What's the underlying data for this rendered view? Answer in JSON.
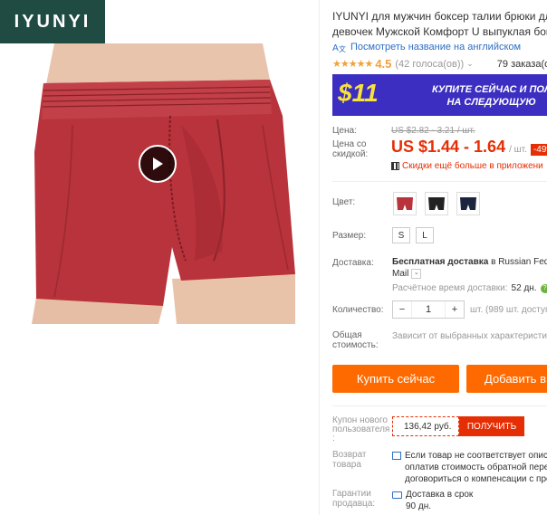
{
  "brand": {
    "logo_text": "IYUNYI"
  },
  "media": {
    "has_video": true
  },
  "product": {
    "title_line1": "IYUNYI для мужчин боксер талии брюки для",
    "title_line2": "девочек Мужской Комфорт U выпуклая бокс",
    "translate_link": "Посмотреть название на английском",
    "rating": "4.5",
    "rating_stars": 4.5,
    "votes": "(42 голоса(ов))",
    "orders": "79 заказа(ов)"
  },
  "banner": {
    "amount": "$11",
    "line1": "КУПИТЕ СЕЙЧАС И ПОЛ",
    "line2": "НА СЛЕДУЮЩУЮ"
  },
  "price": {
    "label": "Цена:",
    "old_value": "US $2.82 - 3.21 / шт.",
    "discount_label": "Цена со скидкой:",
    "sale_value": "US $1.44 - 1.64",
    "per_unit": "/ шт.",
    "discount_badge": "-49%",
    "app_deal": "Скидки ещё больше в приложени"
  },
  "options": {
    "color_label": "Цвет:",
    "colors": [
      "red-boxer",
      "black-boxer",
      "navy-boxer"
    ],
    "size_label": "Размер:",
    "sizes": [
      "S",
      "L"
    ]
  },
  "shipping": {
    "label": "Доставка:",
    "value_bold": "Бесплатная доставка",
    "value_to": "в",
    "destination": "Russian Fede",
    "carrier": "Mail",
    "eta_label": "Расчётное время доставки:",
    "eta_value": "52 дн."
  },
  "quantity": {
    "label": "Количество:",
    "minus": "−",
    "value": "1",
    "plus": "+",
    "available": "шт. (989 шт. доступ"
  },
  "total": {
    "label_line1": "Общая",
    "label_line2": "стоимость:",
    "value": "Зависит от выбранных характеристи"
  },
  "actions": {
    "buy_now": "Купить сейчас",
    "add_to_cart": "Добавить в"
  },
  "coupon": {
    "label_line1": "Купон нового",
    "label_line2": "пользователя",
    "label_line3": ":",
    "amount": "136,42 руб.",
    "get": "ПОЛУЧИТЬ"
  },
  "returns": {
    "label_line1": "Возврат",
    "label_line2": "товара",
    "line1": "Если товар не соответствует описа",
    "line2": "оплатив стоимость обратной пере",
    "line3": "договориться о компенсации с про"
  },
  "guarantee": {
    "label_line1": "Гарантии",
    "label_line2": "продавца:",
    "line1": "Доставка в срок",
    "line2": "90 дн."
  },
  "colors": {
    "accent": "#ff6a00",
    "price_red": "#e62e04",
    "link_blue": "#2e6ec2",
    "logo_bg": "#1f4b43",
    "banner_bg": "#3c2ec1",
    "banner_yellow": "#f7e23c"
  }
}
